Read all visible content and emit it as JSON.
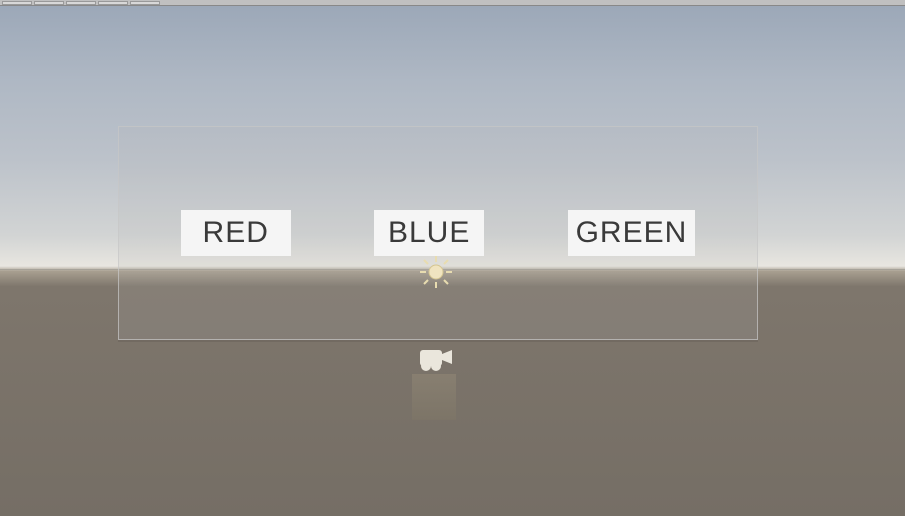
{
  "canvas": {
    "buttons": [
      {
        "label": "RED"
      },
      {
        "label": "BLUE"
      },
      {
        "label": "GREEN"
      }
    ]
  },
  "gizmos": {
    "light": "directional-light",
    "camera": "main-camera",
    "cube": "cube"
  }
}
